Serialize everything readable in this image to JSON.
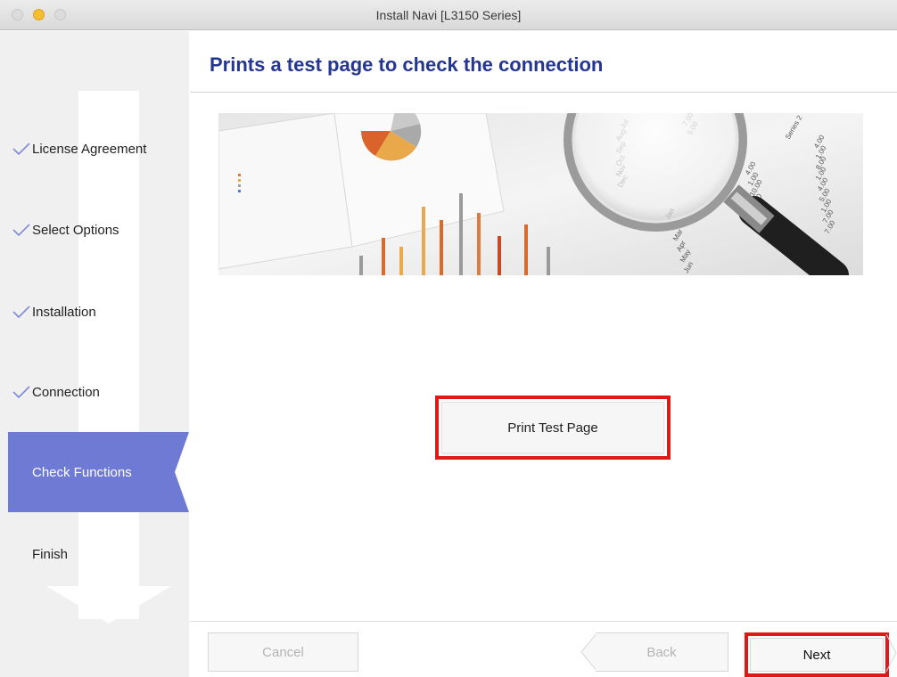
{
  "window": {
    "title": "Install Navi [L3150 Series]"
  },
  "sidebar": {
    "steps": [
      {
        "label": "License Agreement",
        "state": "done"
      },
      {
        "label": "Select Options",
        "state": "done"
      },
      {
        "label": "Installation",
        "state": "done"
      },
      {
        "label": "Connection",
        "state": "done"
      },
      {
        "label": "Check Functions",
        "state": "active"
      },
      {
        "label": "Finish",
        "state": "pending"
      }
    ],
    "active_color": "#6f7ad4"
  },
  "main": {
    "title": "Prints a test page to check the connection",
    "title_color": "#24368f",
    "print_button_label": "Print Test Page",
    "highlight_color": "#e01818"
  },
  "footer": {
    "cancel_label": "Cancel",
    "back_label": "Back",
    "next_label": "Next"
  },
  "hero": {
    "months_left": [
      "Jul",
      "Aug",
      "Sep",
      "Oct",
      "Nov",
      "Dec"
    ],
    "months_right": [
      "Jan",
      "Feb",
      "Mar",
      "Apr",
      "May",
      "Jun",
      "Jul"
    ],
    "series_label": "Series 2",
    "numbers": [
      "4.00",
      "1.00",
      "10.00",
      "5.00",
      "3.00",
      "1.00",
      "7.00"
    ],
    "corner_values": [
      "7.00",
      "5.00"
    ]
  }
}
